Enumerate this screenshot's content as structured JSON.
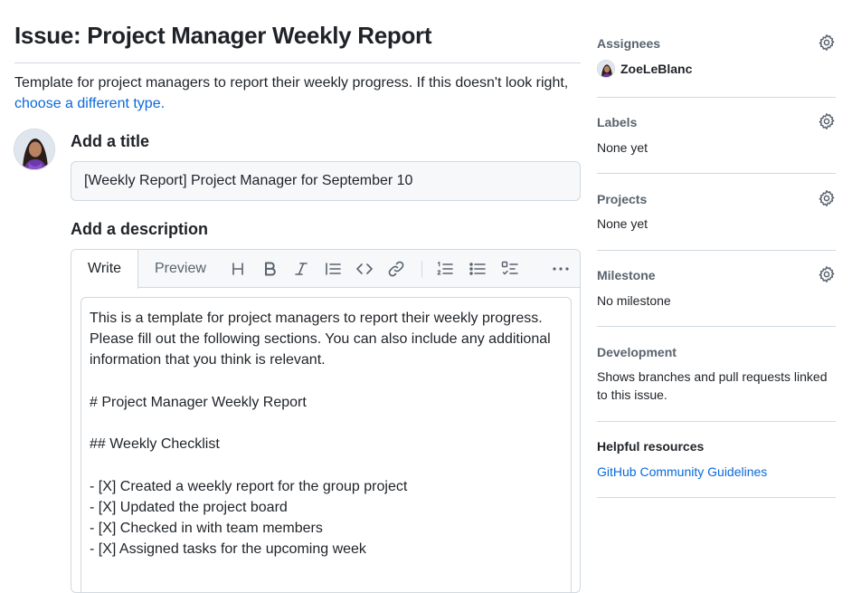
{
  "page": {
    "title": "Issue: Project Manager Weekly Report",
    "template_note": "Template for project managers to report their weekly progress. If this doesn't look right,",
    "template_link": "choose a different type."
  },
  "form": {
    "title_label": "Add a title",
    "title_value": "[Weekly Report] Project Manager for September 10",
    "description_label": "Add a description",
    "tabs": [
      "Write",
      "Preview"
    ],
    "toolbar_icons": [
      "heading-icon",
      "bold-icon",
      "italic-icon",
      "quote-icon",
      "code-icon",
      "link-icon",
      "numbered-list-icon",
      "bulleted-list-icon",
      "task-list-icon",
      "more-icon"
    ],
    "description_lines": [
      "This is a template for project managers to report their weekly progress.",
      "Please fill out the following sections. You can also include any additional",
      "information that you think is relevant.",
      "",
      "# Project Manager Weekly Report",
      "",
      "## Weekly Checklist",
      "",
      "- [X] Created a weekly report for the group project",
      "- [X] Updated the project board",
      "- [X] Checked in with team members",
      "- [X] Assigned tasks for the upcoming week"
    ]
  },
  "sidebar": {
    "assignees": {
      "heading": "Assignees",
      "name": "ZoeLeBlanc"
    },
    "labels": {
      "heading": "Labels",
      "value": "None yet"
    },
    "projects": {
      "heading": "Projects",
      "value": "None yet"
    },
    "milestone": {
      "heading": "Milestone",
      "value": "No milestone"
    },
    "development": {
      "heading": "Development",
      "line1": "Shows branches and pull requests linked",
      "line2": "to this issue."
    },
    "helpful": {
      "heading": "Helpful resources",
      "link": "GitHub Community Guidelines"
    }
  },
  "colors": {
    "link": "#0969da",
    "muted": "#59636e",
    "border": "#d1d9e0",
    "text": "#1f2328"
  }
}
